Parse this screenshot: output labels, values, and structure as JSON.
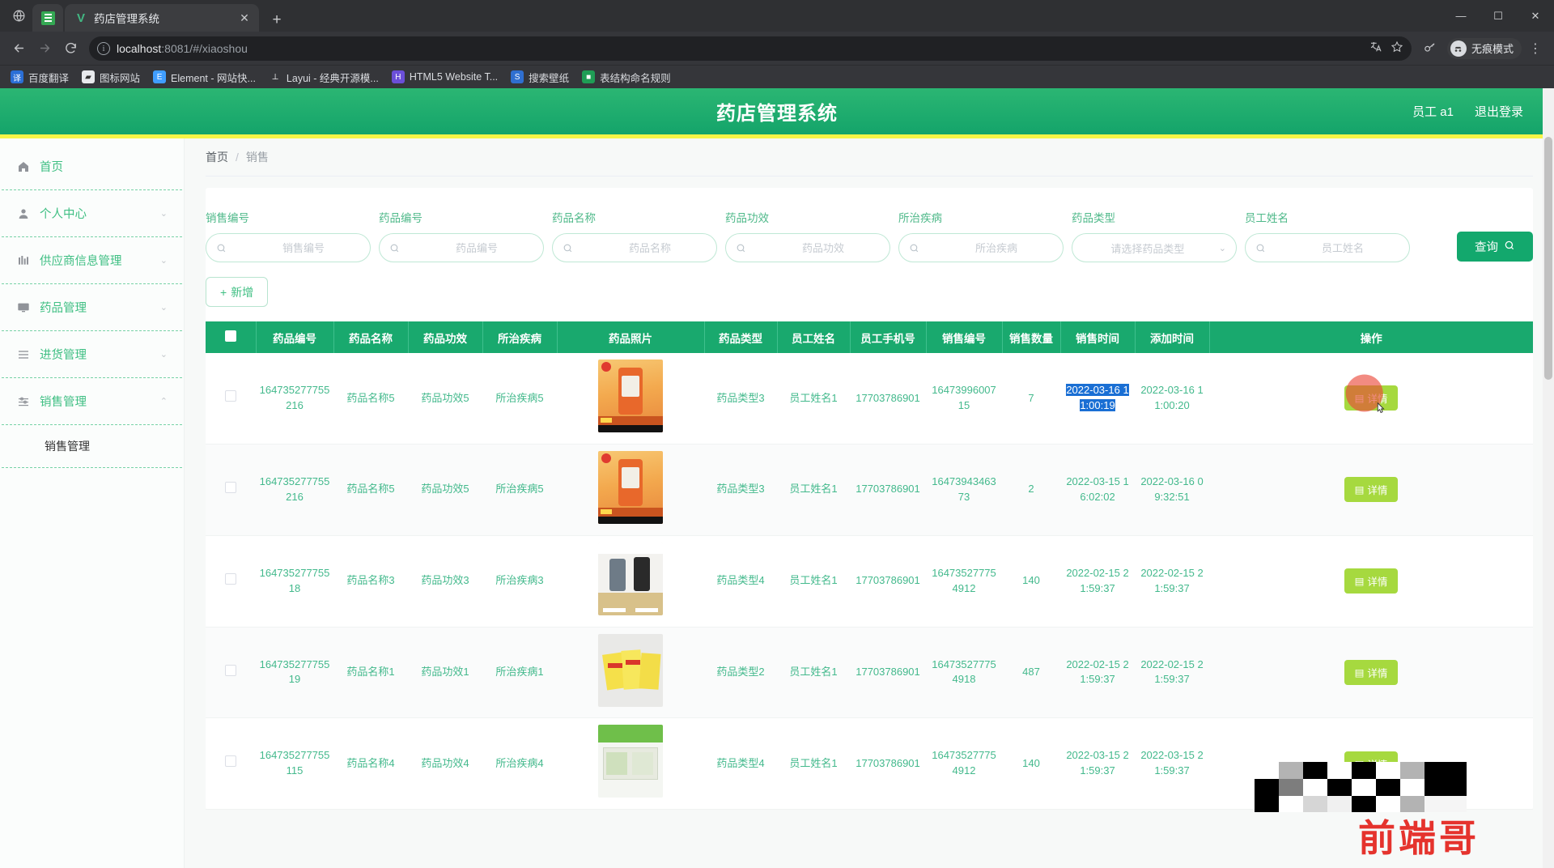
{
  "browser": {
    "tab": {
      "title": "药店管理系统",
      "favicon_icon": "vue-logo-icon",
      "close_icon": "close-icon"
    },
    "newtab_label": "+",
    "window_controls": {
      "minimize": "—",
      "maximize": "☐",
      "close": "✕"
    },
    "nav": {
      "back_icon": "arrow-left-icon",
      "forward_icon": "arrow-right-icon",
      "reload_icon": "reload-icon"
    },
    "omnibox": {
      "info_icon": "info-circle-icon",
      "url_host": "localhost",
      "url_path": ":8081/#/xiaoshou",
      "translate_icon": "translate-icon",
      "star_icon": "star-icon"
    },
    "extensions_icon": "key-icon",
    "profile": {
      "label": "无痕模式",
      "avatar_icon": "incognito-avatar-icon"
    },
    "menu_icon": "kebab-menu-icon",
    "bookmarks": [
      {
        "label": "百度翻译",
        "color": "#2b6fd6",
        "glyph": "译"
      },
      {
        "label": "图标网站",
        "color": "#ffffff",
        "glyph": "▰"
      },
      {
        "label": "Element - 网站快...",
        "color": "#409eff",
        "glyph": "E"
      },
      {
        "label": "Layui - 经典开源模...",
        "color": "#35363a",
        "glyph": "L"
      },
      {
        "label": "HTML5 Website T...",
        "color": "#6b4fd8",
        "glyph": "H"
      },
      {
        "label": "搜索壁纸",
        "color": "#2f6fd0",
        "glyph": "S"
      },
      {
        "label": "表结构命名规则",
        "color": "#1f9d55",
        "glyph": "■"
      }
    ]
  },
  "app": {
    "title": "药店管理系统",
    "user_label": "员工 a1",
    "logout_label": "退出登录",
    "accent": "#14a46a",
    "accent_bar": "#f5f547"
  },
  "sidebar": {
    "items": [
      {
        "label": "首页",
        "icon": "home-icon",
        "arrow": "",
        "active": true
      },
      {
        "label": "个人中心",
        "icon": "user-icon",
        "arrow": "⌄"
      },
      {
        "label": "供应商信息管理",
        "icon": "chart-bar-icon",
        "arrow": "⌄"
      },
      {
        "label": "药品管理",
        "icon": "monitor-icon",
        "arrow": "⌄"
      },
      {
        "label": "进货管理",
        "icon": "list-icon",
        "arrow": "⌄"
      },
      {
        "label": "销售管理",
        "icon": "sliders-icon",
        "arrow": "⌃"
      }
    ],
    "submenu": [
      {
        "label": "销售管理"
      }
    ]
  },
  "breadcrumb": {
    "home": "首页",
    "sep": "/",
    "current": "销售"
  },
  "search": {
    "fields": [
      {
        "label": "销售编号",
        "placeholder": "销售编号",
        "value": "",
        "type": "text",
        "icon": "search-icon"
      },
      {
        "label": "药品编号",
        "placeholder": "药品编号",
        "value": "",
        "type": "text",
        "icon": "search-icon"
      },
      {
        "label": "药品名称",
        "placeholder": "药品名称",
        "value": "",
        "type": "text",
        "icon": "search-icon"
      },
      {
        "label": "药品功效",
        "placeholder": "药品功效",
        "value": "",
        "type": "text",
        "icon": "search-icon"
      },
      {
        "label": "所治疾病",
        "placeholder": "所治疾病",
        "value": "",
        "type": "text",
        "icon": "search-icon"
      },
      {
        "label": "药品类型",
        "placeholder": "请选择药品类型",
        "value": "",
        "type": "select",
        "icon": "chevron-down-icon"
      },
      {
        "label": "员工姓名",
        "placeholder": "员工姓名",
        "value": "",
        "type": "text",
        "icon": "search-icon"
      }
    ],
    "query_label": "查询",
    "query_icon": "search-icon"
  },
  "toolbar": {
    "add_label": "新增",
    "add_icon": "plus-icon"
  },
  "table": {
    "columns": [
      "药品编号",
      "药品名称",
      "药品功效",
      "所治疾病",
      "药品照片",
      "药品类型",
      "员工姓名",
      "员工手机号",
      "销售编号",
      "销售数量",
      "销售时间",
      "添加时间",
      "操作"
    ],
    "detail_label": "详情",
    "detail_icon": "document-icon",
    "rows": [
      {
        "drug_no": "164735277755216",
        "drug_name": "药品名称5",
        "effect": "药品功效5",
        "disease": "所治疾病5",
        "photo": "vitamin-bottle-orange",
        "drug_type": "药品类型3",
        "staff": "员工姓名1",
        "phone": "17703786901",
        "sale_no": "1647399600715",
        "qty": "7",
        "sale_time": "2022-03-16 11:00:19",
        "add_time": "2022-03-16 11:00:20",
        "sale_time_selected": true
      },
      {
        "drug_no": "164735277755216",
        "drug_name": "药品名称5",
        "effect": "药品功效5",
        "disease": "所治疾病5",
        "photo": "vitamin-bottle-orange",
        "drug_type": "药品类型3",
        "staff": "员工姓名1",
        "phone": "17703786901",
        "sale_no": "1647394346373",
        "qty": "2",
        "sale_time": "2022-03-15 16:02:02",
        "add_time": "2022-03-16 09:32:51",
        "sale_time_selected": false
      },
      {
        "drug_no": "16473527775518",
        "drug_name": "药品名称3",
        "effect": "药品功效3",
        "disease": "所治疾病3",
        "photo": "bottles-white-black",
        "drug_type": "药品类型4",
        "staff": "员工姓名1",
        "phone": "17703786901",
        "sale_no": "164735277754912",
        "qty": "140",
        "sale_time": "2022-02-15 21:59:37",
        "add_time": "2022-02-15 21:59:37",
        "sale_time_selected": false
      },
      {
        "drug_no": "16473527775519",
        "drug_name": "药品名称1",
        "effect": "药品功效1",
        "disease": "所治疾病1",
        "photo": "yellow-boxes",
        "drug_type": "药品类型2",
        "staff": "员工姓名1",
        "phone": "17703786901",
        "sale_no": "164735277754918",
        "qty": "487",
        "sale_time": "2022-02-15 21:59:37",
        "add_time": "2022-02-15 21:59:37",
        "sale_time_selected": false
      },
      {
        "drug_no": "164735277755115",
        "drug_name": "药品名称4",
        "effect": "药品功效4",
        "disease": "所治疾病4",
        "photo": "green-package",
        "drug_type": "药品类型4",
        "staff": "员工姓名1",
        "phone": "17703786901",
        "sale_no": "164735277754912",
        "qty": "140",
        "sale_time": "2022-03-15 21:59:37",
        "add_time": "2022-03-15 21:59:37",
        "sale_time_selected": false
      }
    ]
  },
  "watermark": {
    "text": "前端哥",
    "color": "#e5332d",
    "qr_label": "qr-code-watermark"
  },
  "cursor": {
    "name": "mouse-pointer",
    "highlight_color": "#ea4335"
  }
}
